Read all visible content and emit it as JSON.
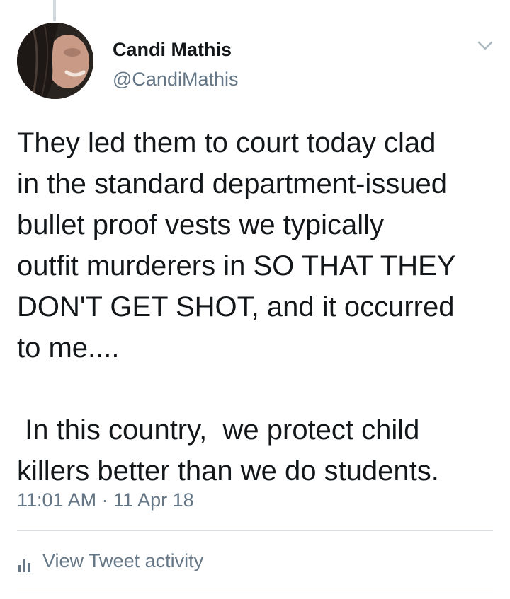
{
  "tweet": {
    "author": {
      "display_name": "Candi Mathis",
      "handle": "@CandiMathis"
    },
    "text": "They led them to court today clad\nin the standard department-issued\nbullet proof vests we typically\noutfit murderers in SO THAT THEY\nDON'T GET SHOT, and it occurred\nto me....\n\n In this country,  we protect child\nkillers better than we do students.",
    "timestamp": "11:01 AM · 11 Apr 18",
    "activity_label": "View Tweet activity"
  },
  "icons": {
    "menu": "chevron-down-icon",
    "activity": "bar-chart-icon"
  },
  "colors": {
    "secondary_text": "#657786",
    "primary_text": "#14171a",
    "divider": "#d8dee2"
  }
}
